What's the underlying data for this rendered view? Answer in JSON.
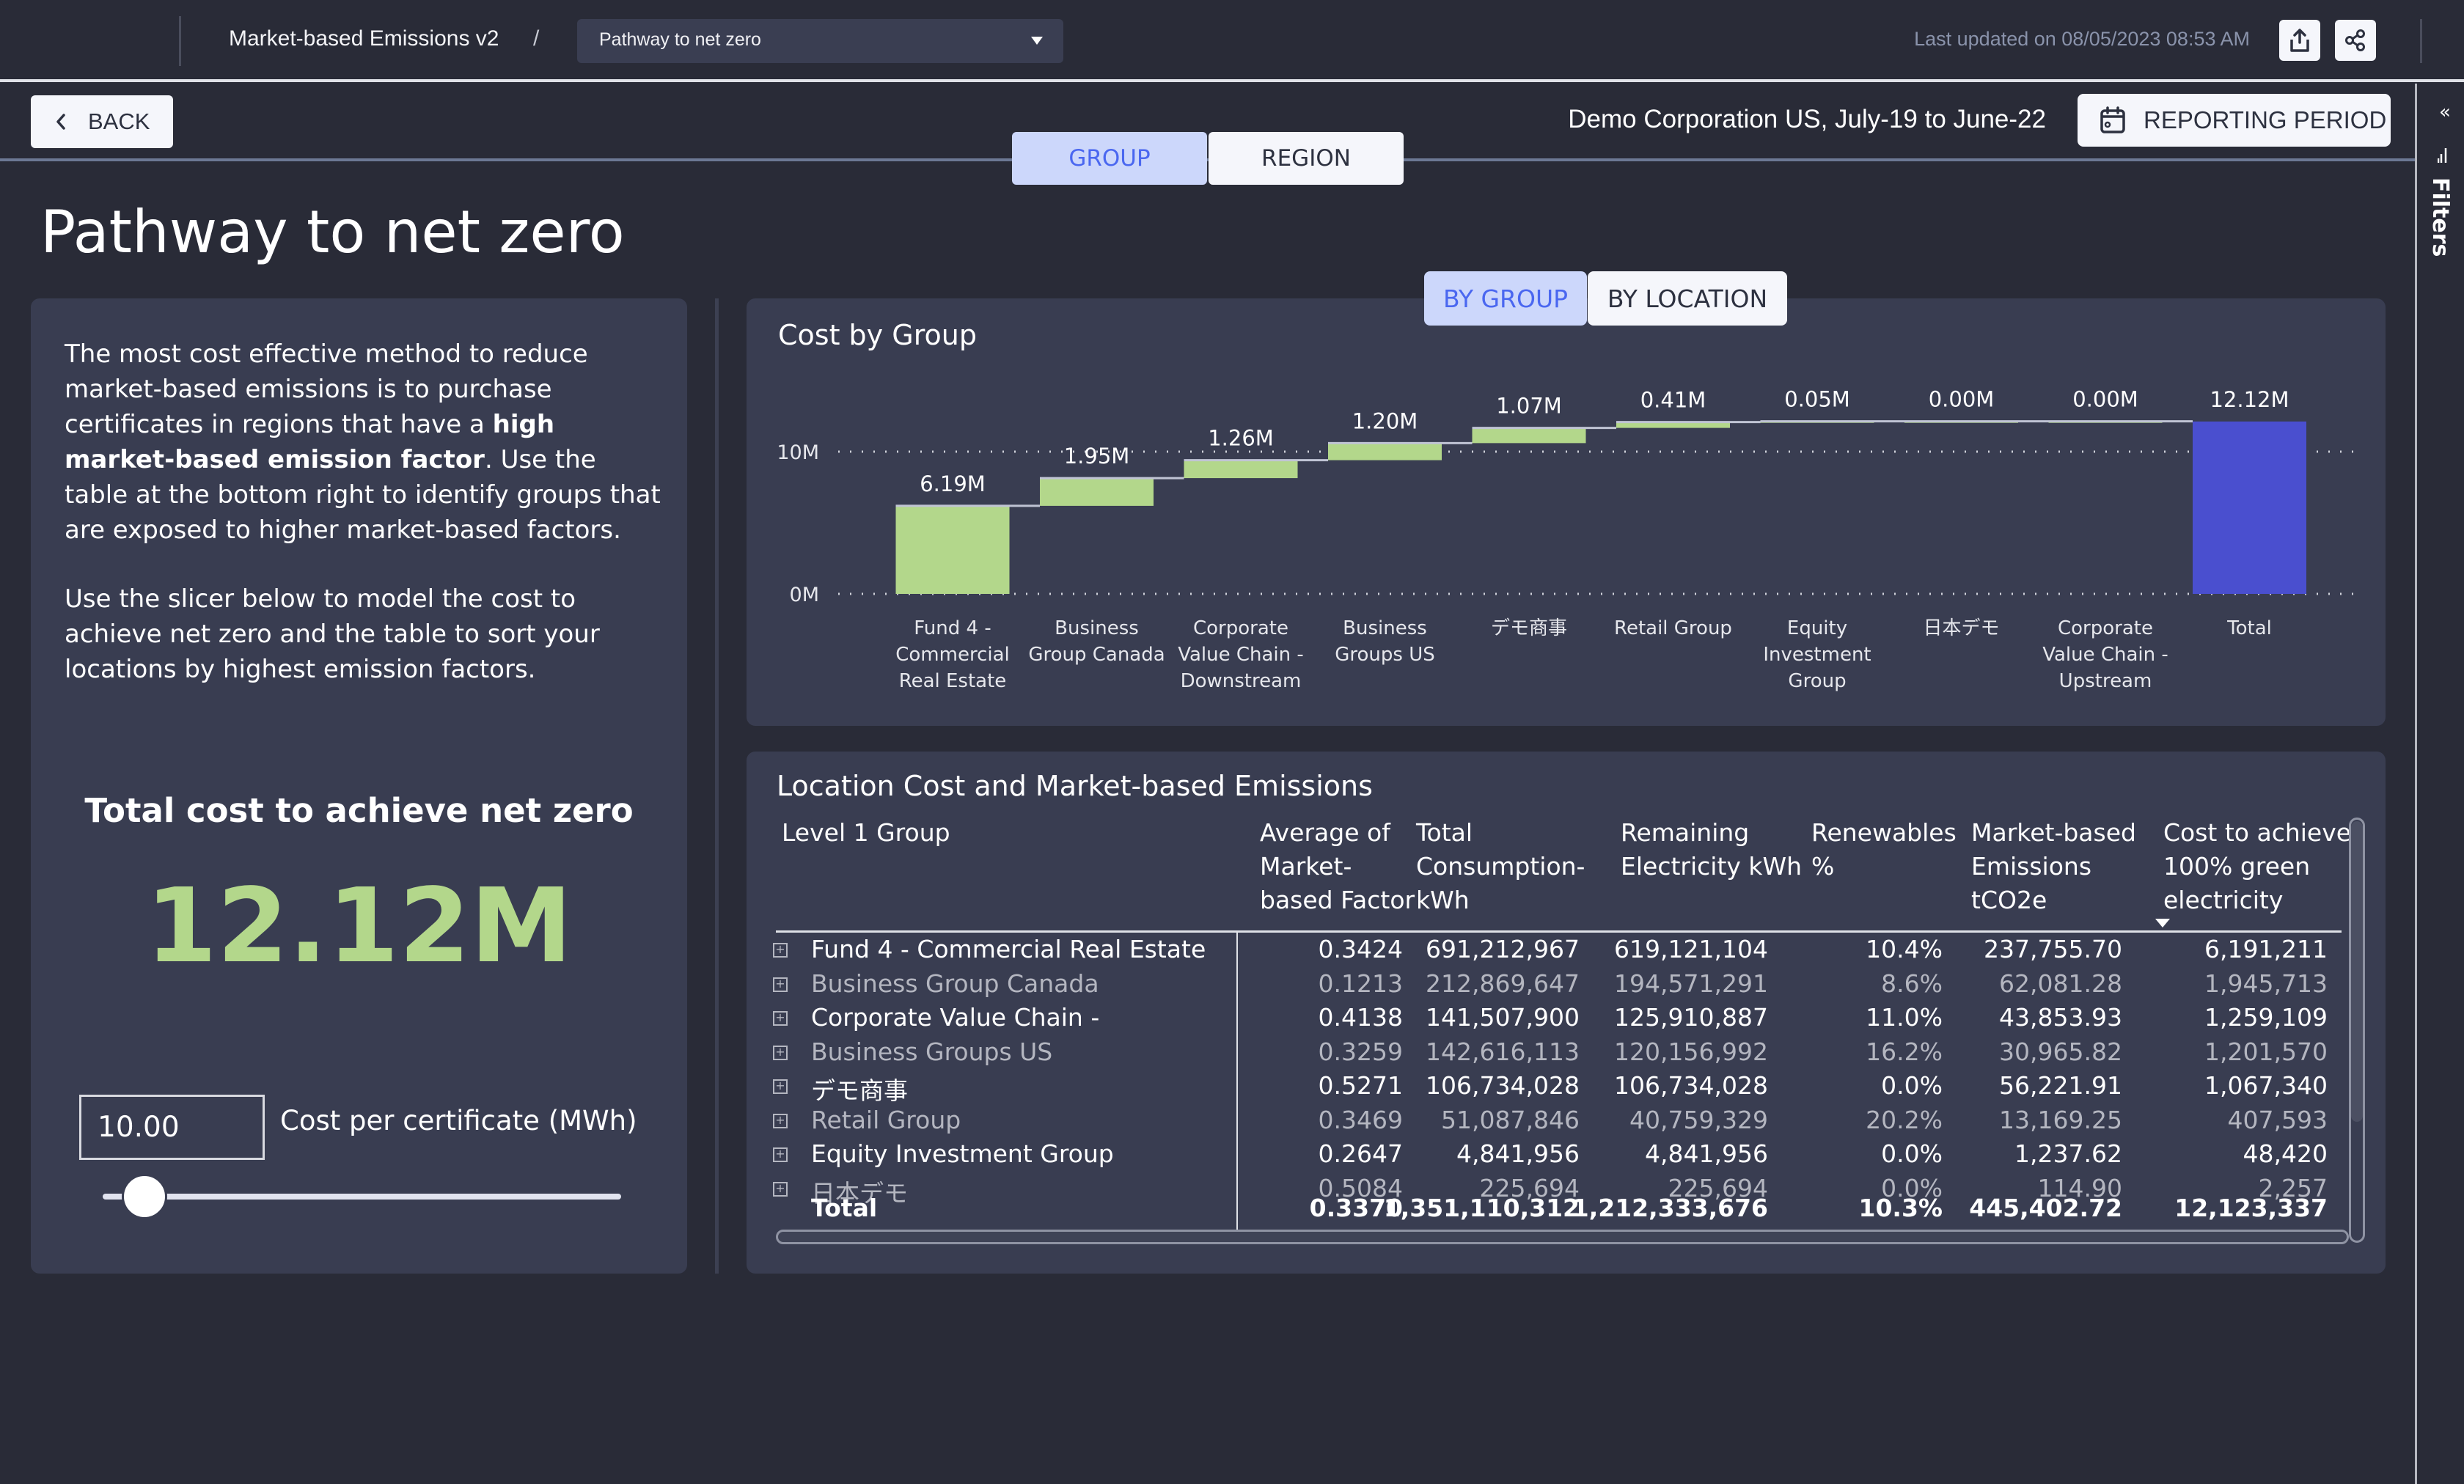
{
  "header": {
    "app_title": "Market-based Emissions v2",
    "breadcrumb_separator": "/",
    "page_selector": {
      "selected": "Pathway to net zero"
    },
    "last_updated": "Last updated on 08/05/2023 08:53 AM",
    "export_icon": "export-icon",
    "share_icon": "share-icon"
  },
  "filters_panel": {
    "label": "Filters",
    "collapse_icon": "«"
  },
  "toolbar": {
    "back_label": "BACK",
    "tabs": [
      {
        "label": "GROUP",
        "active": true
      },
      {
        "label": "REGION",
        "active": false
      }
    ],
    "context": "Demo Corporation US, July-19 to June-22",
    "reporting_period_label": "REPORTING PERIOD"
  },
  "page_title": "Pathway to net zero",
  "info_card": {
    "intro_part1": "The most cost effective method to reduce market-based emissions is to purchase certificates in regions that have a ",
    "intro_bold": "high market-based emission factor",
    "intro_part2": ". Use the table at the bottom right to identify groups that are exposed to higher market-based factors.",
    "intro_para2": "Use the slicer below to model the cost to achieve net zero and the table to sort your locations by highest emission factors.",
    "kpi_title": "Total cost to achieve net zero",
    "kpi_value": "12.12M",
    "cost_input_value": "10.00",
    "cost_label": "Cost per certificate (MWh)",
    "slider_fraction": 0.08
  },
  "chart_toggle": [
    {
      "label": "BY GROUP",
      "active": true
    },
    {
      "label": "BY LOCATION",
      "active": false
    }
  ],
  "chart_data": {
    "type": "bar",
    "subtype": "waterfall",
    "title": "Cost by Group",
    "categories": [
      [
        "Fund 4 -",
        "Commercial",
        "Real Estate"
      ],
      [
        "Business",
        "Group Canada"
      ],
      [
        "Corporate",
        "Value Chain -",
        "Downstream"
      ],
      [
        "Business",
        "Groups US"
      ],
      [
        "デモ商事"
      ],
      [
        "Retail Group"
      ],
      [
        "Equity",
        "Investment",
        "Group"
      ],
      [
        "日本デモ"
      ],
      [
        "Corporate",
        "Value Chain -",
        "Upstream"
      ],
      [
        "Total"
      ]
    ],
    "values": [
      6.19,
      1.95,
      1.26,
      1.2,
      1.07,
      0.41,
      0.05,
      0.0,
      0.0,
      12.12
    ],
    "data_labels": [
      "6.19M",
      "1.95M",
      "1.26M",
      "1.20M",
      "1.07M",
      "0.41M",
      "0.05M",
      "0.00M",
      "0.00M",
      "12.12M"
    ],
    "is_total": [
      false,
      false,
      false,
      false,
      false,
      false,
      false,
      false,
      false,
      true
    ],
    "units": "M",
    "yticks": [
      {
        "value": 0,
        "label": "0M"
      },
      {
        "value": 10,
        "label": "10M"
      }
    ],
    "ylim": [
      0,
      12.12
    ],
    "grid": "dotted",
    "colors": {
      "increase": "#b3d78b",
      "total": "#4a4fcf",
      "connector": "#c0c4d4"
    }
  },
  "table": {
    "title": "Location Cost and Market-based Emissions",
    "columns": [
      "Level 1 Group",
      "Average of Market-based Factor",
      "Total Consumption-kWh",
      "Remaining Electricity kWh",
      "Renewables %",
      "Market-based Emissions tCO2e",
      "Cost to achieve 100% green electricity"
    ],
    "column_lines": [
      [
        "Level 1 Group"
      ],
      [
        "Average of",
        "Market-",
        "based Factor"
      ],
      [
        "Total",
        "Consumption-",
        "kWh"
      ],
      [
        "Remaining",
        "Electricity kWh"
      ],
      [
        "Renewables",
        "%"
      ],
      [
        "Market-based",
        "Emissions",
        "tCO2e"
      ],
      [
        "Cost to achieve",
        "100% green",
        "electricity"
      ]
    ],
    "sorted_column": "Cost to achieve 100% green electricity",
    "sort_direction": "descending",
    "rows": [
      {
        "group": "Fund 4 - Commercial Real Estate",
        "factor": "0.3424",
        "consumption": "691,212,967",
        "remaining": "619,121,104",
        "renewables": "10.4%",
        "emissions": "237,755.70",
        "cost": "6,191,211"
      },
      {
        "group": "Business Group Canada",
        "factor": "0.1213",
        "consumption": "212,869,647",
        "remaining": "194,571,291",
        "renewables": "8.6%",
        "emissions": "62,081.28",
        "cost": "1,945,713"
      },
      {
        "group": "Corporate Value Chain -",
        "factor": "0.4138",
        "consumption": "141,507,900",
        "remaining": "125,910,887",
        "renewables": "11.0%",
        "emissions": "43,853.93",
        "cost": "1,259,109"
      },
      {
        "group": "Business Groups US",
        "factor": "0.3259",
        "consumption": "142,616,113",
        "remaining": "120,156,992",
        "renewables": "16.2%",
        "emissions": "30,965.82",
        "cost": "1,201,570"
      },
      {
        "group": "デモ商事",
        "factor": "0.5271",
        "consumption": "106,734,028",
        "remaining": "106,734,028",
        "renewables": "0.0%",
        "emissions": "56,221.91",
        "cost": "1,067,340"
      },
      {
        "group": "Retail Group",
        "factor": "0.3469",
        "consumption": "51,087,846",
        "remaining": "40,759,329",
        "renewables": "20.2%",
        "emissions": "13,169.25",
        "cost": "407,593"
      },
      {
        "group": "Equity Investment Group",
        "factor": "0.2647",
        "consumption": "4,841,956",
        "remaining": "4,841,956",
        "renewables": "0.0%",
        "emissions": "1,237.62",
        "cost": "48,420"
      },
      {
        "group": "日本デモ",
        "factor": "0.5084",
        "consumption": "225,694",
        "remaining": "225,694",
        "renewables": "0.0%",
        "emissions": "114.90",
        "cost": "2,257"
      }
    ],
    "total": {
      "group": "Total",
      "factor": "0.3370",
      "consumption": "1,351,110,312",
      "remaining": "1,212,333,676",
      "renewables": "10.3%",
      "emissions": "445,402.72",
      "cost": "12,123,337"
    }
  }
}
